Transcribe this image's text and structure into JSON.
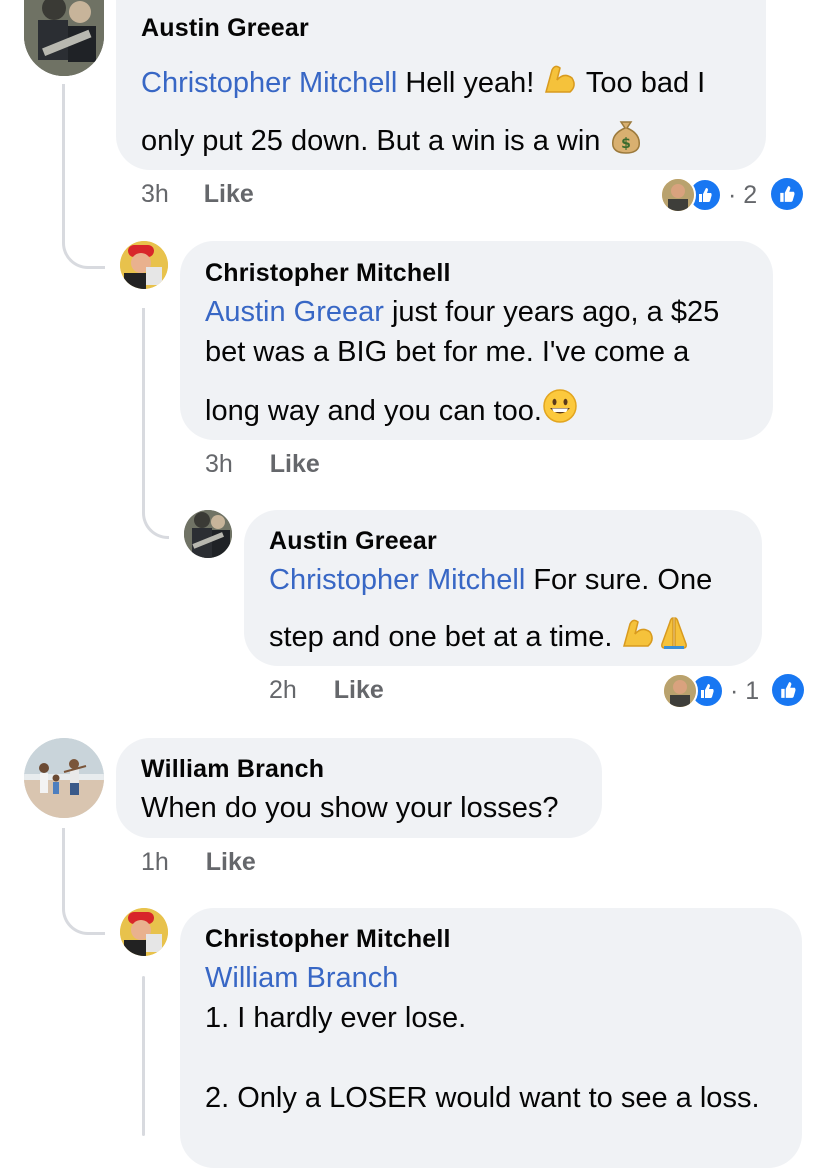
{
  "comments": [
    {
      "author": "Austin Greear",
      "mention": "Christopher Mitchell",
      "line1": "Hell yeah!",
      "line1b": "Too bad I",
      "line2": "only put 25 down. But a win is a win",
      "time": "3h",
      "like": "Like",
      "reaction_count": "2"
    },
    {
      "author": "Christopher Mitchell",
      "mention": "Austin Greear",
      "line1": "just four years ago, a $25",
      "line2": "bet was a BIG bet for me. I've come a",
      "line3": "long way and you can too.",
      "time": "3h",
      "like": "Like"
    },
    {
      "author": "Austin Greear",
      "mention": "Christopher Mitchell",
      "line1": "For sure. One",
      "line2": "step and one bet at a time.",
      "time": "2h",
      "like": "Like",
      "reaction_count": "1"
    },
    {
      "author": "William Branch",
      "line1": "When do you show your losses?",
      "time": "1h",
      "like": "Like"
    },
    {
      "author": "Christopher Mitchell",
      "mention": "William Branch",
      "line1": "1. I hardly ever lose.",
      "line2": "2. Only a LOSER would want to see a loss."
    }
  ],
  "reaction_separator": "·",
  "colors": {
    "mention": "#3867c5",
    "bubble": "#f0f2f5",
    "like_blue": "#1877f2",
    "meta": "#65676b"
  }
}
